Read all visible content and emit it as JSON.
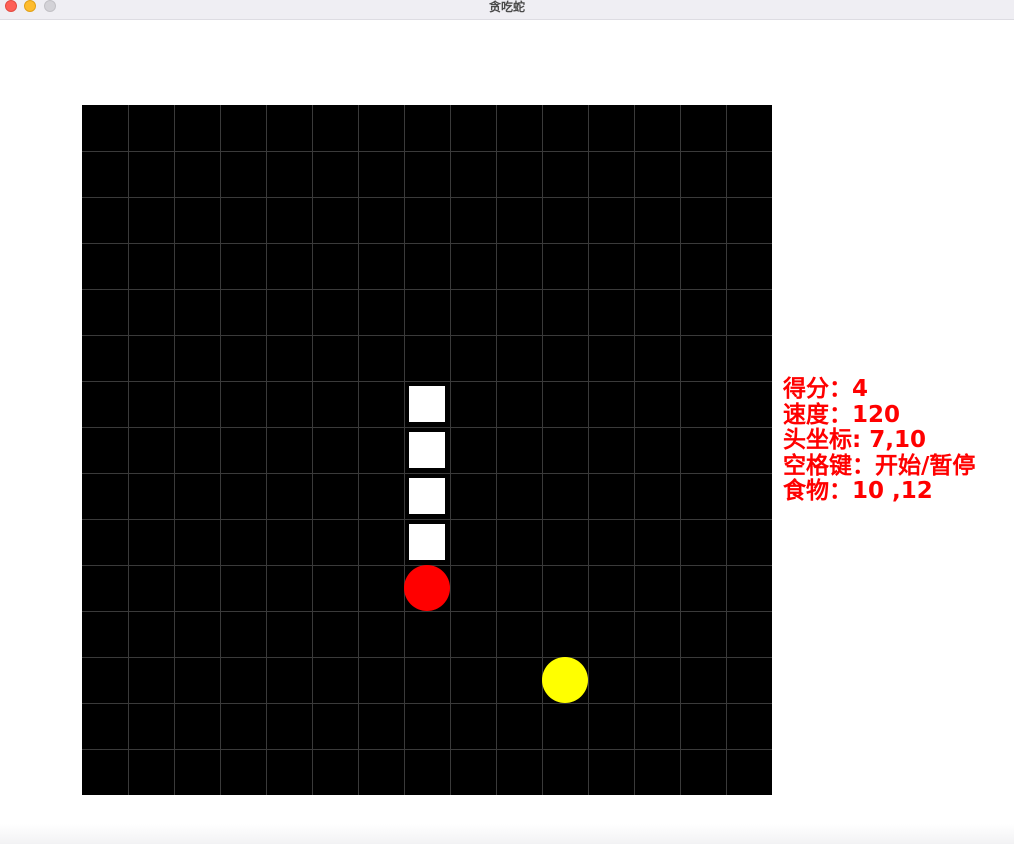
{
  "window": {
    "title": "贪吃蛇"
  },
  "game": {
    "grid_cols": 15,
    "grid_rows": 15,
    "snake_cells": [
      [
        7,
        6
      ],
      [
        7,
        7
      ],
      [
        7,
        8
      ],
      [
        7,
        9
      ]
    ],
    "head_cell": [
      7,
      10
    ],
    "food_cell": [
      10,
      12
    ],
    "colors": {
      "board": "#000000",
      "grid": "#3a3a3a",
      "snake_body": "#ffffff",
      "snake_head": "#ff0000",
      "food": "#ffff00",
      "info_text": "#ff0000"
    }
  },
  "info": {
    "score": "得分：4",
    "speed": "速度：120",
    "head_coord": "头坐标: 7,10",
    "hint": "空格键：开始/暂停",
    "food": "食物：10 ,12"
  }
}
